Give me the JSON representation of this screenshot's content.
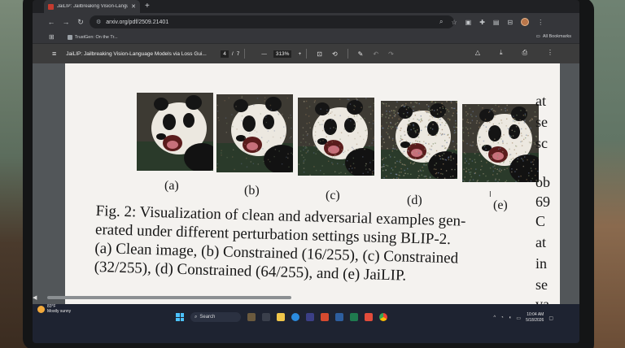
{
  "tab": {
    "title": "JaiLIP: Jailbreaking Vision-Langu",
    "close": "✕",
    "new_tab": "+"
  },
  "omnibox": {
    "url": "arxiv.org/pdf/2509.21401"
  },
  "bookmarks": {
    "item": "TrustGen: On the Tr...",
    "all": "All Bookmarks"
  },
  "pdf": {
    "title": "JaiLIP: Jailbreaking Vision-Language Models via Loss Gui...",
    "page_current": "4",
    "page_sep": "/",
    "page_total": "7",
    "zoom_minus": "—",
    "zoom": "313%",
    "zoom_plus": "+"
  },
  "figure": {
    "labels": [
      "(a)",
      "(b)",
      "(c)",
      "(d)",
      "(e)"
    ],
    "caption": [
      "Fig. 2: Visualization of clean and adversarial examples gen-",
      "erated under different perturbation settings using BLIP-2.",
      "(a) Clean image, (b) Constrained (16/255), (c) Constrained",
      "(32/255), (d) Constrained (64/255), and (e) JaiLIP."
    ],
    "side_fragments": [
      "at",
      "se",
      "sc",
      "ob",
      "69",
      "C",
      "at",
      "in",
      "se",
      "va"
    ]
  },
  "taskbar": {
    "temp": "83°F",
    "weather": "Mostly sunny",
    "search": "Search",
    "time": "10:04 AM",
    "date": "5/18/2026"
  },
  "colors": {
    "accent": "#4cc2ff",
    "pdf_toolbar": "#3c3c3c",
    "chrome_dark": "#202124"
  }
}
